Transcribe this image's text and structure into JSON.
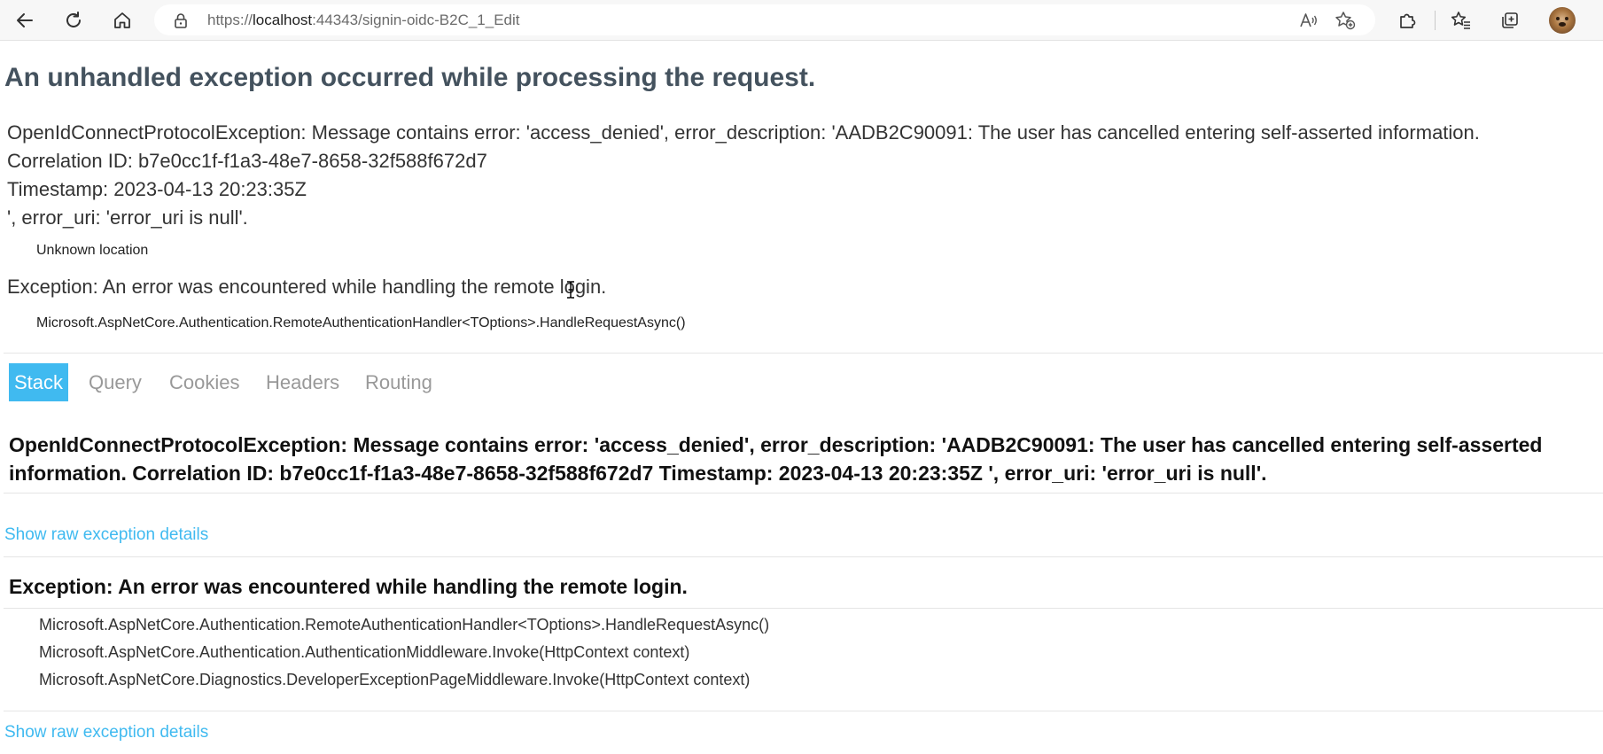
{
  "browser": {
    "url_prefix": "https://",
    "url_host": "localhost",
    "url_rest": ":44343/signin-oidc-B2C_1_Edit"
  },
  "page": {
    "title": "An unhandled exception occurred while processing the request.",
    "summary_lines": [
      "OpenIdConnectProtocolException: Message contains error: 'access_denied', error_description: 'AADB2C90091: The user has cancelled entering self-asserted information.",
      "Correlation ID: b7e0cc1f-f1a3-48e7-8658-32f588f672d7",
      "Timestamp: 2023-04-13 20:23:35Z",
      "', error_uri: 'error_uri is null'."
    ],
    "summary_location": "Unknown location",
    "inner_exception": "Exception: An error was encountered while handling the remote login.",
    "inner_location": "Microsoft.AspNetCore.Authentication.RemoteAuthenticationHandler<TOptions>.HandleRequestAsync()"
  },
  "tabs": [
    {
      "label": "Stack",
      "active": true
    },
    {
      "label": "Query",
      "active": false
    },
    {
      "label": "Cookies",
      "active": false
    },
    {
      "label": "Headers",
      "active": false
    },
    {
      "label": "Routing",
      "active": false
    }
  ],
  "stack": {
    "exception1_heading": "OpenIdConnectProtocolException: Message contains error: 'access_denied', error_description: 'AADB2C90091: The user has cancelled entering self-asserted information. Correlation ID: b7e0cc1f-f1a3-48e7-8658-32f588f672d7 Timestamp: 2023-04-13 20:23:35Z ', error_uri: 'error_uri is null'.",
    "raw_link_label": "Show raw exception details",
    "exception2_heading": "Exception: An error was encountered while handling the remote login.",
    "frames": [
      "Microsoft.AspNetCore.Authentication.RemoteAuthenticationHandler<TOptions>.HandleRequestAsync()",
      "Microsoft.AspNetCore.Authentication.AuthenticationMiddleware.Invoke(HttpContext context)",
      "Microsoft.AspNetCore.Diagnostics.DeveloperExceptionPageMiddleware.Invoke(HttpContext context)"
    ]
  },
  "colors": {
    "accent": "#40baf0",
    "title": "#44525e"
  }
}
